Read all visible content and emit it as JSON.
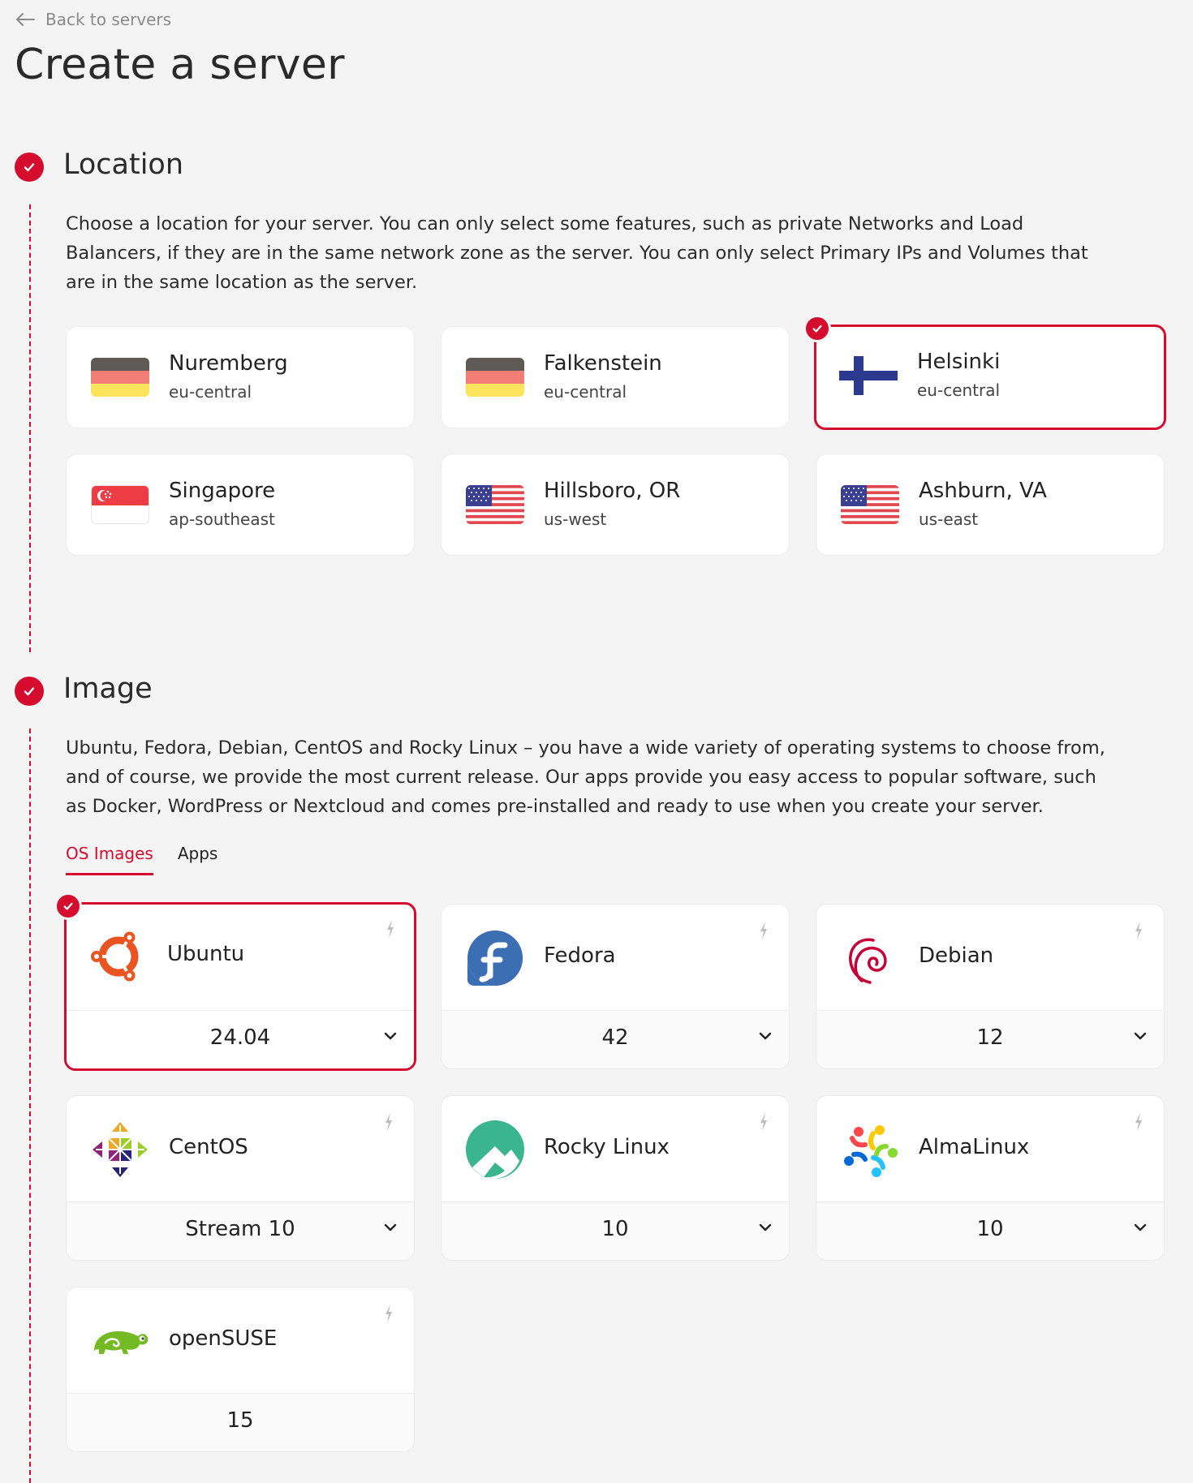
{
  "nav": {
    "back_label": "Back to servers"
  },
  "page": {
    "title": "Create a server"
  },
  "location": {
    "title": "Location",
    "description": "Choose a location for your server. You can only select some features, such as private Networks and Load Balancers, if they are in the same network zone as the server. You can only select Primary IPs and Volumes that are in the same location as the server.",
    "items": [
      {
        "name": "Nuremberg",
        "zone": "eu-central",
        "flag": "germany-flag"
      },
      {
        "name": "Falkenstein",
        "zone": "eu-central",
        "flag": "germany-flag"
      },
      {
        "name": "Helsinki",
        "zone": "eu-central",
        "flag": "finland-flag",
        "selected": true
      },
      {
        "name": "Singapore",
        "zone": "ap-southeast",
        "flag": "singapore-flag"
      },
      {
        "name": "Hillsboro, OR",
        "zone": "us-west",
        "flag": "usa-flag"
      },
      {
        "name": "Ashburn, VA",
        "zone": "us-east",
        "flag": "usa-flag"
      }
    ]
  },
  "image": {
    "title": "Image",
    "description": "Ubuntu, Fedora, Debian, CentOS and Rocky Linux – you have a wide variety of operating systems to choose from, and of course, we provide the most current release. Our apps provide you easy access to popular software, such as Docker, WordPress or Nextcloud and comes pre-installed and ready to use when you create your server.",
    "tabs": [
      {
        "label": "OS Images",
        "active": true
      },
      {
        "label": "Apps",
        "active": false
      }
    ],
    "os": [
      {
        "name": "Ubuntu",
        "version": "24.04",
        "icon": "ubuntu-logo-icon",
        "selected": true,
        "dropdown": true
      },
      {
        "name": "Fedora",
        "version": "42",
        "icon": "fedora-logo-icon",
        "dropdown": true
      },
      {
        "name": "Debian",
        "version": "12",
        "icon": "debian-logo-icon",
        "dropdown": true
      },
      {
        "name": "CentOS",
        "version": "Stream 10",
        "icon": "centos-logo-icon",
        "dropdown": true
      },
      {
        "name": "Rocky Linux",
        "version": "10",
        "icon": "rocky-linux-logo-icon",
        "dropdown": true
      },
      {
        "name": "AlmaLinux",
        "version": "10",
        "icon": "almalinux-logo-icon",
        "dropdown": true
      },
      {
        "name": "openSUSE",
        "version": "15",
        "icon": "opensuse-logo-icon",
        "dropdown": false
      }
    ]
  },
  "colors": {
    "accent": "#d50c2d",
    "background": "#f4f4f4",
    "card": "#ffffff"
  }
}
